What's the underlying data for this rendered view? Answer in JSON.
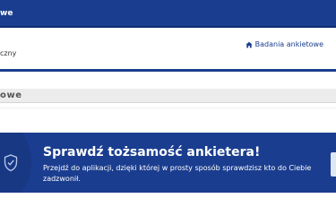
{
  "topbar": {
    "title": "we"
  },
  "header": {
    "subtitle": "czny",
    "link_label": "Badania ankietowe",
    "link_icon": "home-icon"
  },
  "section": {
    "title": "owe"
  },
  "banner": {
    "title": "Sprawdź tożsamość ankietera!",
    "text": "Przejdź do aplikacji, dzięki której w prosty sposób sprawdzisz kto do Ciebie zadzwonił.",
    "icon": "shield-check-icon"
  },
  "colors": {
    "primary": "#1a3d8f",
    "white": "#ffffff",
    "section_bg": "#ececec"
  }
}
